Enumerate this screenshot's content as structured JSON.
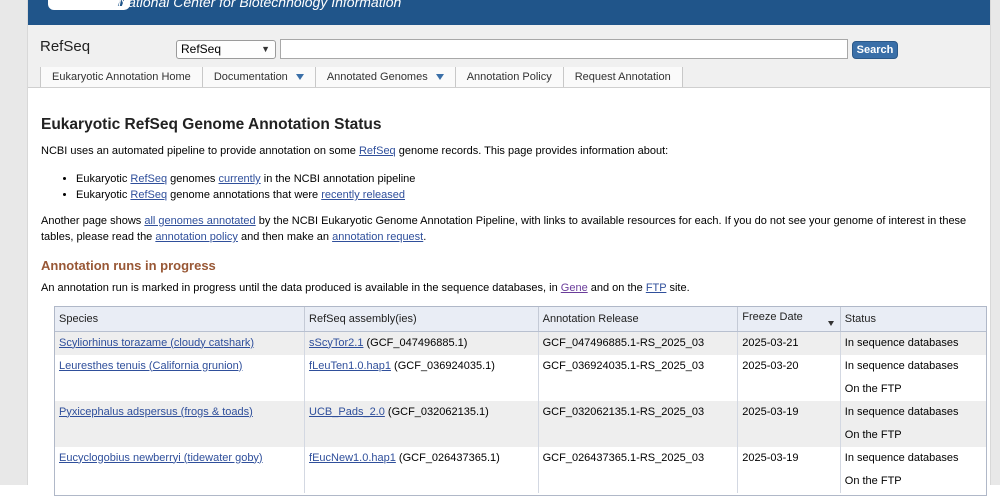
{
  "header": {
    "org_title": "National Center for Biotechnology Information"
  },
  "search": {
    "db_name": "RefSeq",
    "db_select_value": "RefSeq",
    "query": "",
    "button_label": "Search"
  },
  "nav": {
    "items": [
      {
        "label": "Eukaryotic Annotation Home",
        "dropdown": false
      },
      {
        "label": "Documentation",
        "dropdown": true
      },
      {
        "label": "Annotated Genomes",
        "dropdown": true
      },
      {
        "label": "Annotation Policy",
        "dropdown": false
      },
      {
        "label": "Request Annotation",
        "dropdown": false
      }
    ]
  },
  "page": {
    "title": "Eukaryotic RefSeq Genome Annotation Status",
    "intro_before": "NCBI uses an automated pipeline to provide annotation on some ",
    "intro_link": "RefSeq",
    "intro_after": " genome records. This page provides information about:",
    "bullets": [
      {
        "before": "Eukaryotic ",
        "link1": "RefSeq",
        "middle": " genomes ",
        "link2": "currently",
        "after": " in the NCBI annotation pipeline"
      },
      {
        "before": "Eukaryotic ",
        "link1": "RefSeq",
        "middle": " genome annotations that were ",
        "link2": "recently released",
        "after": ""
      }
    ],
    "para2": {
      "t1": "Another page shows ",
      "l1": "all genomes annotated",
      "t2": " by the NCBI Eukaryotic Genome Annotation Pipeline, with links to available resources for each. If you do not see your genome of interest in these tables, please read the ",
      "l2": "annotation policy",
      "t3": " and then make an ",
      "l3": "annotation request",
      "t4": "."
    },
    "section_title": "Annotation runs in progress",
    "section_desc": {
      "t1": "An annotation run is marked in progress until the data produced is available in the sequence databases, in ",
      "l1": "Gene",
      "t2": " and on the ",
      "l2": "FTP",
      "t3": " site."
    }
  },
  "table": {
    "columns": [
      "Species",
      "RefSeq assembly(ies)",
      "Annotation Release",
      "Freeze Date",
      "Status"
    ],
    "rows": [
      {
        "species": "Scyliorhinus torazame (cloudy catshark)",
        "assembly_link": "sScyTor2.1",
        "assembly_acc": " (GCF_047496885.1)",
        "release": "GCF_047496885.1-RS_2025_03",
        "freeze": "2025-03-21",
        "status": [
          "In sequence databases"
        ]
      },
      {
        "species": "Leuresthes tenuis (California grunion)",
        "assembly_link": "fLeuTen1.0.hap1",
        "assembly_acc": " (GCF_036924035.1)",
        "release": "GCF_036924035.1-RS_2025_03",
        "freeze": "2025-03-20",
        "status": [
          "In sequence databases",
          "On the FTP"
        ]
      },
      {
        "species": "Pyxicephalus adspersus (frogs & toads)",
        "assembly_link": "UCB_Pads_2.0",
        "assembly_acc": " (GCF_032062135.1)",
        "release": "GCF_032062135.1-RS_2025_03",
        "freeze": "2025-03-19",
        "status": [
          "In sequence databases",
          "On the FTP"
        ]
      },
      {
        "species": "Eucyclogobius newberryi (tidewater goby)",
        "assembly_link": "fEucNew1.0.hap1",
        "assembly_acc": " (GCF_026437365.1)",
        "release": "GCF_026437365.1-RS_2025_03",
        "freeze": "2025-03-19",
        "status": [
          "In sequence databases",
          "On the FTP"
        ]
      }
    ]
  }
}
